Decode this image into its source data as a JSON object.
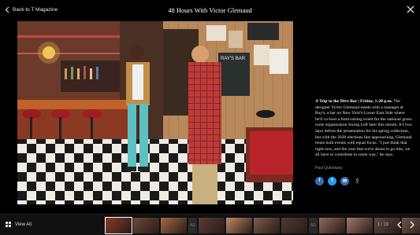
{
  "header": {
    "back_label": "Back to T Magazine",
    "title": "48 Hours With Victor Glemaud"
  },
  "photo": {
    "alt": "Victor Glemaud and a manager at Ray's bar",
    "sign_text": "RAY'S BAR"
  },
  "caption": {
    "lead": "A Trip to the Dive Bar | Friday, 1:20 p.m.",
    "body": "The designer Victor Glemaud meets with a manager at Ray's, a bar on New York's Lower East Side where he'll co-host a fund-raising event for the national grass-roots organization Swing Left later this month. It's two days before the presentation for his spring collection, but with the 2020 elections fast approaching, Glemaud treats both events with equal focus. \"I just think that right now, and the year that we're about to go into, we all have to contribute in some way,\" he says.",
    "credit": "Paul Quitoriano"
  },
  "share": {
    "facebook": "f",
    "twitter": "t",
    "email": "✉",
    "more": "⇪"
  },
  "footer": {
    "view_all_label": "View All",
    "counter": "1 / 19",
    "ad_label": "AD"
  },
  "thumbnails": [
    {
      "color": "#8a3b2e",
      "active": true
    },
    {
      "color": "#6b4a3a"
    },
    {
      "color": "#a56a4a"
    },
    {
      "color": "#5a3d3a"
    },
    {
      "color": "#c08a6a"
    },
    {
      "color": "#7b5d4d"
    },
    {
      "color": "#4d3b35"
    },
    {
      "color": "#8e6a5a"
    },
    {
      "color": "#a07a6a"
    },
    {
      "color": "#5d4a40"
    },
    {
      "color": "#6e5548"
    }
  ],
  "colors": {
    "background": "#000000",
    "share_blue": "#2f6fb5"
  }
}
